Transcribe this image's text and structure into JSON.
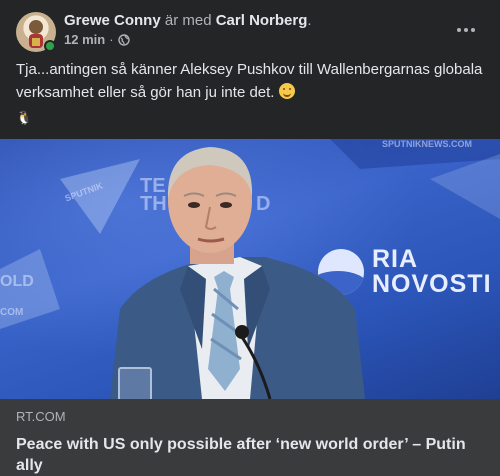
{
  "post": {
    "author_name": "Grewe Conny",
    "connector": " är med ",
    "tagged_name": "Carl Norberg",
    "suffix": ".",
    "time": "12 min",
    "separator": "·",
    "audience_icon": "globe-icon",
    "more_icon": "more-options-icon",
    "text": "Tja...antingen så känner Aleksey Pushkov till Wallenbergarnas globala verksamhet eller så gör han ju inte det.",
    "emoji": "smiling-face-emoji",
    "extra_emoji": "🐧"
  },
  "photo": {
    "ria_line1": "RIA",
    "ria_line2": "NOVOSTI",
    "bg_left_top": "TE",
    "bg_left_mid": "TH",
    "bg_right_mid": "D",
    "bg_edge_1": "OLD",
    "bg_edge_2": "COM",
    "bg_sputnik": "SPUTNIK",
    "bg_top_right": "SPUTNIKNEWS.COM"
  },
  "link_preview": {
    "domain": "RT.COM",
    "title": "Peace with US only possible after ‘new world order’ – Putin ally"
  },
  "colors": {
    "background": "#242526",
    "card": "#3a3b3c",
    "text_primary": "#e4e6eb",
    "text_secondary": "#b0b3b8",
    "online": "#31a24c",
    "photo_blue": "#2b55b8"
  }
}
